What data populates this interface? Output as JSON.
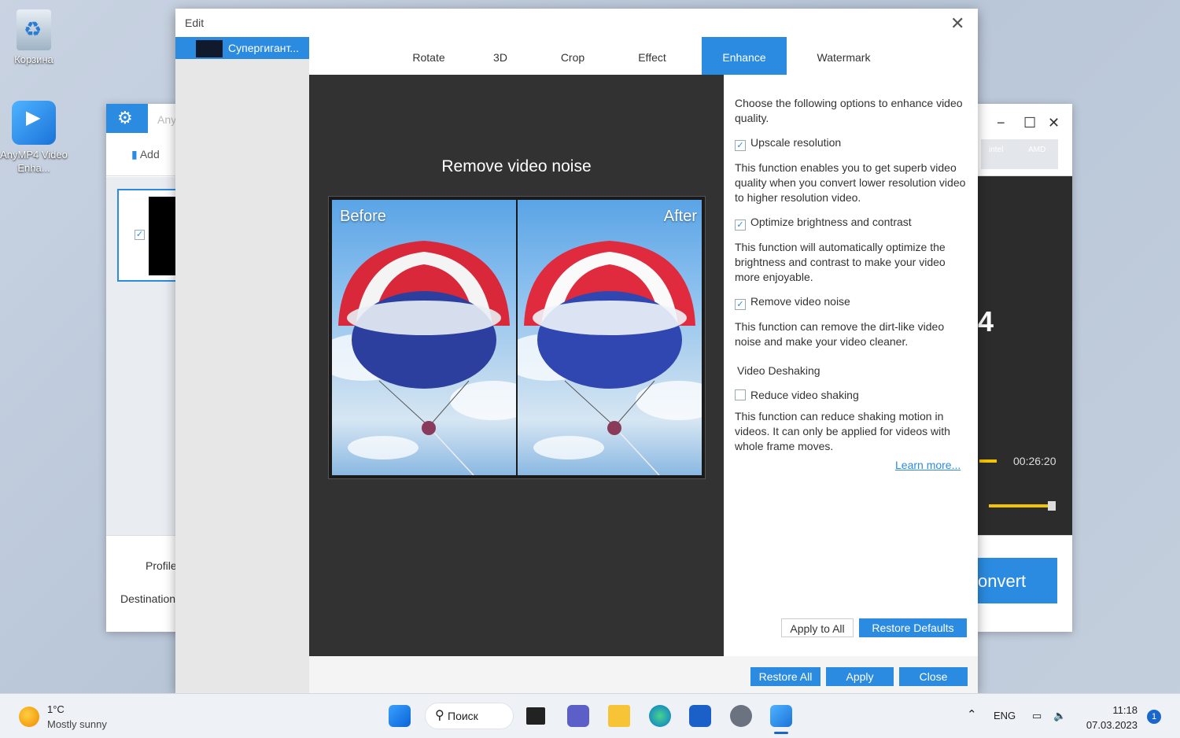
{
  "desktop": {
    "icons": [
      {
        "label": "Корзина",
        "icon": "recycle-bin-icon"
      },
      {
        "label": "AnyMP4 Video Enha...",
        "icon": "anymp4-app-icon"
      }
    ]
  },
  "background_window": {
    "title": "Any",
    "add_label": "Add",
    "profile_label": "Profile",
    "destination_label": "Destination",
    "chip_intel": "intel",
    "chip_amd": "AMD",
    "preview_digit": "4",
    "duration": "00:26:20",
    "volume_level": 0.95,
    "convert_label": "onvert"
  },
  "dialog": {
    "title": "Edit",
    "file_name": "Супергигант...",
    "tabs": [
      {
        "label": "Rotate"
      },
      {
        "label": "3D"
      },
      {
        "label": "Crop"
      },
      {
        "label": "Effect"
      },
      {
        "label": "Enhance",
        "active": true
      },
      {
        "label": "Watermark"
      }
    ],
    "preview": {
      "title": "Remove video noise",
      "before_label": "Before",
      "after_label": "After"
    },
    "enhance": {
      "intro": "Choose the following options to enhance video quality.",
      "options": [
        {
          "label": "Upscale resolution",
          "checked": true,
          "desc": "This function enables you to get superb video quality when you convert lower resolution video to higher resolution video."
        },
        {
          "label": "Optimize brightness and contrast",
          "checked": true,
          "desc": "This function will automatically optimize the brightness and contrast to make your video more enjoyable."
        },
        {
          "label": "Remove video noise",
          "checked": true,
          "desc": "This function can remove the dirt-like video noise and make your video cleaner."
        }
      ],
      "deshake_heading": "Video Deshaking",
      "deshake": {
        "label": "Reduce video shaking",
        "checked": false,
        "desc": "This function can reduce shaking motion in videos. It can only be applied for videos with whole frame moves."
      },
      "learn_more": "Learn more...",
      "apply_to_all": "Apply to All",
      "restore_defaults": "Restore Defaults"
    },
    "footer": {
      "restore_all": "Restore All",
      "apply": "Apply",
      "close": "Close"
    }
  },
  "taskbar": {
    "temperature": "1°C",
    "weather": "Mostly sunny",
    "search": "Поиск",
    "lang": "ENG",
    "time": "11:18",
    "date": "07.03.2023",
    "notifications": "1",
    "colors": {
      "accent": "#2b8be0"
    }
  }
}
